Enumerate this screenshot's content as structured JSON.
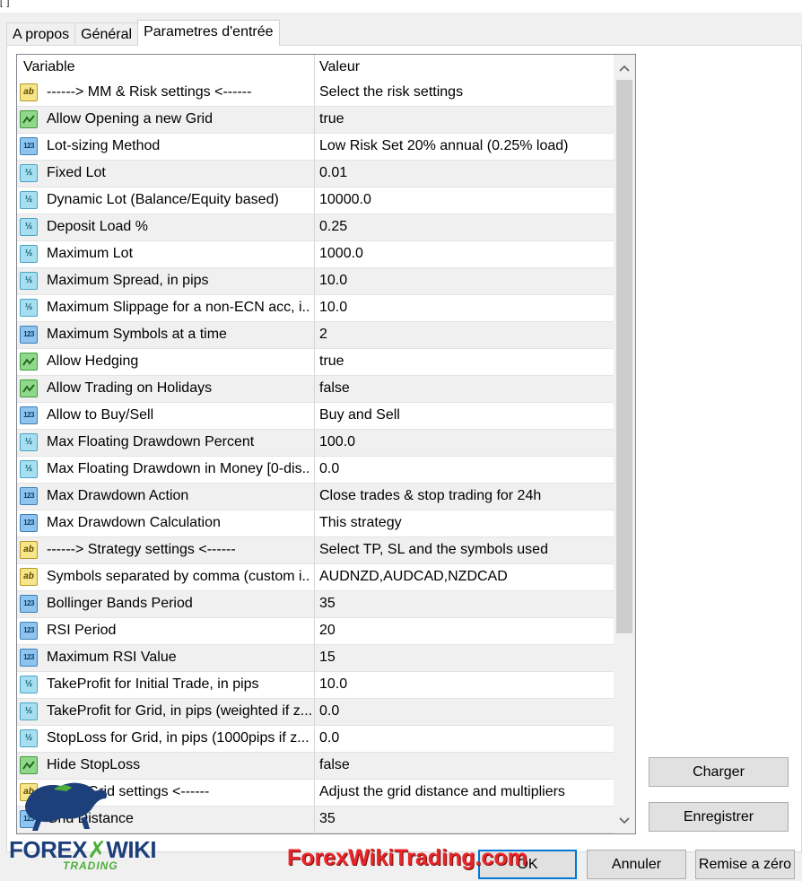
{
  "title_fragment": "[ ]",
  "tabs": [
    {
      "label": "A propos",
      "active": false
    },
    {
      "label": "Général",
      "active": false
    },
    {
      "label": "Parametres d'entrée",
      "active": true
    }
  ],
  "table": {
    "headers": {
      "variable": "Variable",
      "value": "Valeur"
    },
    "rows": [
      {
        "type": "string",
        "name": "------> MM & Risk settings <------",
        "value": "Select the risk settings"
      },
      {
        "type": "bool",
        "name": "Allow Opening a new Grid",
        "value": "true"
      },
      {
        "type": "int",
        "name": "Lot-sizing Method",
        "value": "Low Risk Set 20% annual (0.25% load)"
      },
      {
        "type": "double",
        "name": "Fixed Lot",
        "value": "0.01"
      },
      {
        "type": "double",
        "name": "Dynamic Lot (Balance/Equity based)",
        "value": "10000.0"
      },
      {
        "type": "double",
        "name": "Deposit Load %",
        "value": "0.25"
      },
      {
        "type": "double",
        "name": "Maximum Lot",
        "value": "1000.0"
      },
      {
        "type": "double",
        "name": "Maximum Spread, in pips",
        "value": "10.0"
      },
      {
        "type": "double",
        "name": "Maximum Slippage for a non-ECN acc, i...",
        "value": "10.0"
      },
      {
        "type": "int",
        "name": "Maximum Symbols at a time",
        "value": "2"
      },
      {
        "type": "bool",
        "name": "Allow Hedging",
        "value": "true"
      },
      {
        "type": "bool",
        "name": "Allow Trading on Holidays",
        "value": "false"
      },
      {
        "type": "int",
        "name": "Allow to Buy/Sell",
        "value": "Buy and Sell"
      },
      {
        "type": "double",
        "name": "Max Floating Drawdown Percent",
        "value": "100.0"
      },
      {
        "type": "double",
        "name": "Max Floating Drawdown in Money [0-dis...",
        "value": "0.0"
      },
      {
        "type": "int",
        "name": "Max Drawdown Action",
        "value": "Close trades & stop trading for 24h"
      },
      {
        "type": "int",
        "name": "Max Drawdown Calculation",
        "value": "This strategy"
      },
      {
        "type": "string",
        "name": "------> Strategy settings <------",
        "value": "Select TP, SL and the symbols used"
      },
      {
        "type": "string",
        "name": "Symbols separated by comma (custom i...",
        "value": "AUDNZD,AUDCAD,NZDCAD"
      },
      {
        "type": "int",
        "name": "Bollinger Bands Period",
        "value": "35"
      },
      {
        "type": "int",
        "name": "RSI Period",
        "value": "20"
      },
      {
        "type": "int",
        "name": "Maximum RSI Value",
        "value": "15"
      },
      {
        "type": "double",
        "name": "TakeProfit for Initial Trade, in pips",
        "value": "10.0"
      },
      {
        "type": "double",
        "name": "TakeProfit for Grid, in pips (weighted if z...",
        "value": "0.0"
      },
      {
        "type": "double",
        "name": "StopLoss for Grid, in pips (1000pips if z...",
        "value": "0.0"
      },
      {
        "type": "bool",
        "name": "Hide StopLoss",
        "value": "false"
      },
      {
        "type": "string",
        "name": "------> Grid settings <------",
        "value": "Adjust the grid distance and multipliers"
      },
      {
        "type": "int",
        "name": "Grid Distance",
        "value": "35"
      }
    ]
  },
  "buttons": {
    "load": "Charger",
    "save": "Enregistrer",
    "ok": "OK",
    "cancel": "Annuler",
    "reset": "Remise a zéro"
  },
  "logo": {
    "line1": "FOREX",
    "line2": "WIKI",
    "line3": "TRADING"
  },
  "watermark": "ForexWikiTrading.com",
  "colors": {
    "selection_border": "#0078d7",
    "watermark": "#e8262a",
    "logo_blue": "#1d3f7a",
    "logo_green": "#4caf3a"
  }
}
